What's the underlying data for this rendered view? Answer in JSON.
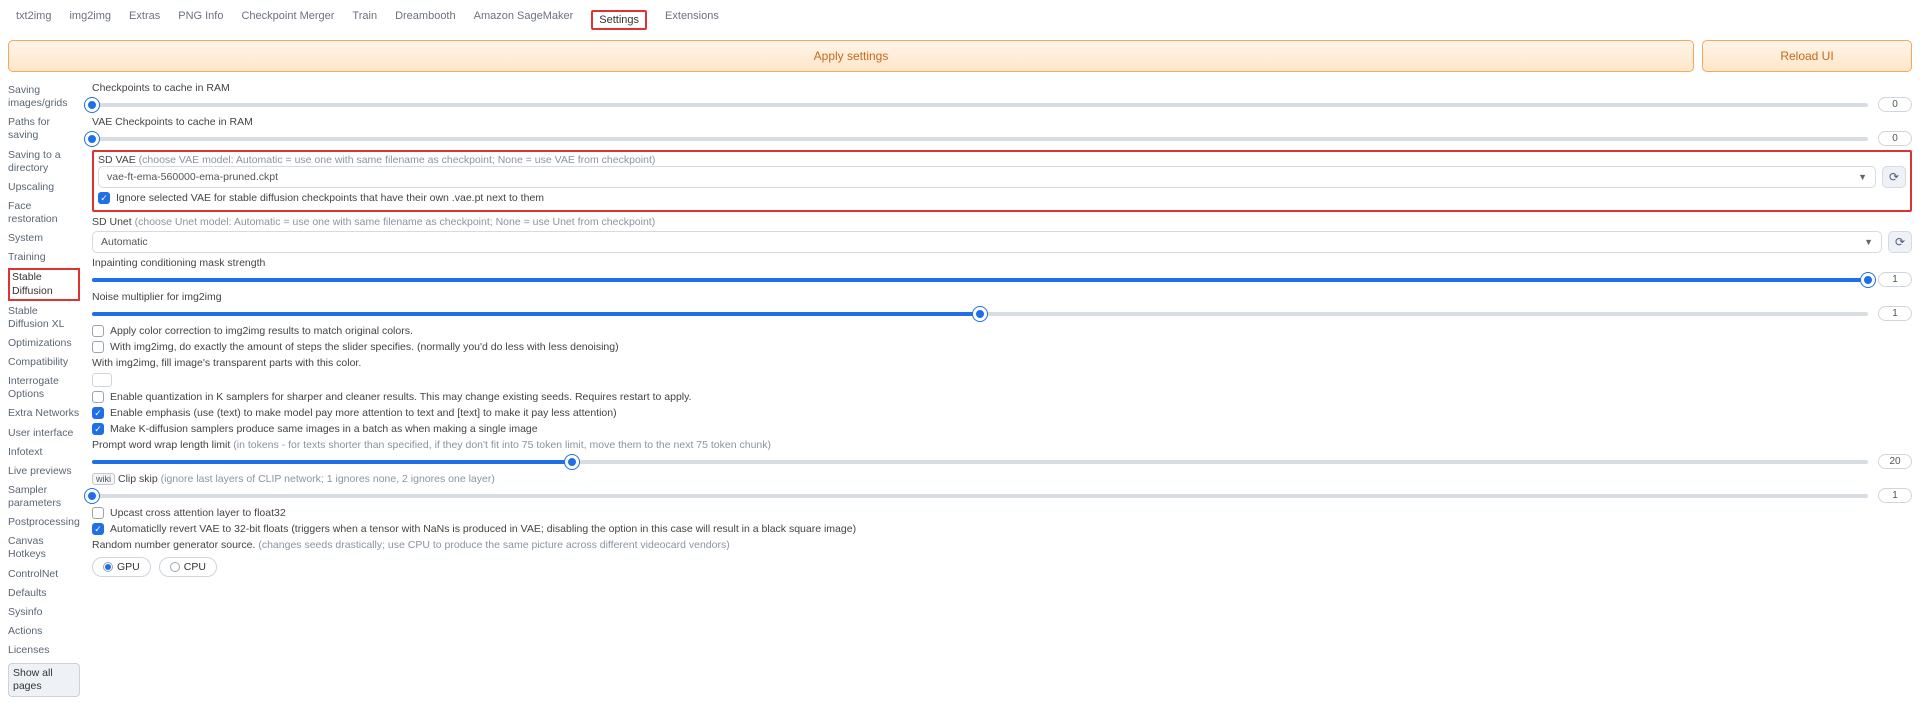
{
  "tabs": [
    "txt2img",
    "img2img",
    "Extras",
    "PNG Info",
    "Checkpoint Merger",
    "Train",
    "Dreambooth",
    "Amazon SageMaker",
    "Settings",
    "Extensions"
  ],
  "active_tab": "Settings",
  "buttons": {
    "apply": "Apply settings",
    "reload": "Reload UI"
  },
  "sidebar": {
    "items": [
      "Saving images/grids",
      "Paths for saving",
      "Saving to a directory",
      "Upscaling",
      "Face restoration",
      "System",
      "Training",
      "Stable Diffusion",
      "Stable Diffusion XL",
      "Optimizations",
      "Compatibility",
      "Interrogate Options",
      "Extra Networks",
      "User interface",
      "Infotext",
      "Live previews",
      "Sampler parameters",
      "Postprocessing",
      "Canvas Hotkeys",
      "ControlNet",
      "Defaults",
      "Sysinfo",
      "Actions",
      "Licenses",
      "Show all pages"
    ],
    "highlight": "Stable Diffusion"
  },
  "sliders": {
    "ckpt_cache": {
      "label": "Checkpoints to cache in RAM",
      "value": 0,
      "pct": 0
    },
    "vae_cache": {
      "label": "VAE Checkpoints to cache in RAM",
      "value": 0,
      "pct": 0
    },
    "inpaint": {
      "label": "Inpainting conditioning mask strength",
      "value": 1,
      "pct": 100
    },
    "noise": {
      "label": "Noise multiplier for img2img",
      "value": 1,
      "pct": 50
    },
    "prompt_wrap": {
      "label": "Prompt word wrap length limit",
      "hint": "(in tokens - for texts shorter than specified, if they don't fit into 75 token limit, move them to the next 75 token chunk)",
      "value": 20,
      "pct": 27
    },
    "clip_skip": {
      "label": "Clip skip",
      "badge": "wiki",
      "hint": "(ignore last layers of CLIP network; 1 ignores none, 2 ignores one layer)",
      "value": 1,
      "pct": 0
    }
  },
  "sd_vae": {
    "label": "SD VAE",
    "hint": "(choose VAE model: Automatic = use one with same filename as checkpoint; None = use VAE from checkpoint)",
    "value": "vae-ft-ema-560000-ema-pruned.ckpt"
  },
  "sd_unet": {
    "label": "SD Unet",
    "hint": "(choose Unet model: Automatic = use one with same filename as checkpoint; None = use Unet from checkpoint)",
    "value": "Automatic"
  },
  "checks": {
    "ignore_vae": {
      "on": true,
      "text": "Ignore selected VAE for stable diffusion checkpoints that have their own .vae.pt next to them"
    },
    "color_corr": {
      "on": false,
      "text": "Apply color correction to img2img results to match original colors."
    },
    "exact_steps": {
      "on": false,
      "text": "With img2img, do exactly the amount of steps the slider specifies.",
      "hint": "(normally you'd do less with less denoising)"
    },
    "quant": {
      "on": false,
      "text": "Enable quantization in K samplers for sharper and cleaner results. This may change existing seeds. Requires restart to apply."
    },
    "emphasis": {
      "on": true,
      "text": "Enable emphasis",
      "hint": "(use (text) to make model pay more attention to text and [text] to make it pay less attention)"
    },
    "kdiff": {
      "on": true,
      "text": "Make K-diffusion samplers produce same images in a batch as when making a single image"
    },
    "upcast": {
      "on": false,
      "text": "Upcast cross attention layer to float32"
    },
    "revert_vae": {
      "on": true,
      "text": "Automaticlly revert VAE to 32-bit floats",
      "hint": "(triggers when a tensor with NaNs is produced in VAE; disabling the option in this case will result in a black square image)"
    }
  },
  "fill_label": "With img2img, fill image's transparent parts with this color.",
  "rng": {
    "label": "Random number generator source.",
    "hint": "(changes seeds drastically; use CPU to produce the same picture across different videocard vendors)",
    "options": [
      "GPU",
      "CPU"
    ],
    "selected": "GPU"
  }
}
